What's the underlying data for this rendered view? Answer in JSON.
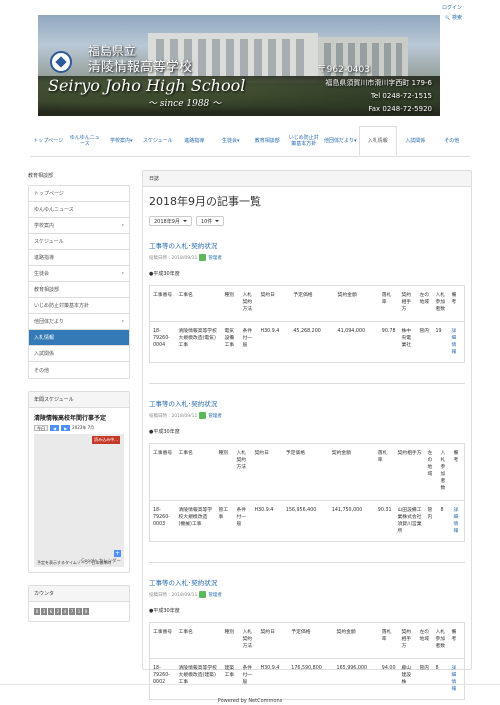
{
  "header": {
    "login": "ログイン",
    "search": "検索"
  },
  "banner": {
    "name_line1": "福島県立",
    "name_line2": "清陵情報高等学校",
    "name_en": "Seiryo Joho High School",
    "since": "〜 since 1988 〜",
    "zip": "〒962-0403",
    "address": "福島県須賀川市滑川字西町 179-6",
    "tel": "Tel  0248-72-1515",
    "fax": "Fax  0248-72-5920"
  },
  "gnav": [
    "トップページ",
    "ゆんゆんニュース",
    "学校案内",
    "スケジュール",
    "進路指導",
    "生徒会",
    "教育相談部",
    "いじめ防止対策基本方針",
    "他団体だより",
    "入札情報",
    "入試関係",
    "その他"
  ],
  "gnav_carets": [
    "",
    "",
    " ▾",
    "",
    "",
    " ▾",
    "",
    "",
    " ▾",
    "",
    "",
    ""
  ],
  "sidebar": {
    "heading": "教育相談部",
    "items": [
      {
        "label": "トップページ",
        "chevron": ""
      },
      {
        "label": "ゆんゆんニュース",
        "chevron": ""
      },
      {
        "label": "学校案内",
        "chevron": "›"
      },
      {
        "label": "スケジュール",
        "chevron": ""
      },
      {
        "label": "進路指導",
        "chevron": ""
      },
      {
        "label": "生徒会",
        "chevron": "›"
      },
      {
        "label": "教育相談部",
        "chevron": ""
      },
      {
        "label": "いじめ防止対策基本方針",
        "chevron": ""
      },
      {
        "label": "他団体だより",
        "chevron": "›"
      },
      {
        "label": "入札情報",
        "chevron": ""
      },
      {
        "label": "入試関係",
        "chevron": ""
      },
      {
        "label": "その他",
        "chevron": ""
      }
    ],
    "calendar": {
      "panel_title": "年間スケジュール",
      "title": "清陵情報高校年間行事予定",
      "today": "今日",
      "prev": "◀",
      "next": "▶",
      "month": "2023年 7月",
      "loading": "読み込み中...",
      "footer": "予定を表示するタイムゾーン: 日本標準時",
      "brand": "Google カレンダー"
    },
    "counter": {
      "title": "カウンタ",
      "digits": [
        "0",
        "3",
        "6",
        "2",
        "4",
        "7",
        "1",
        "9"
      ]
    }
  },
  "main": {
    "breadcrumb": "日誌",
    "title": "2018年9月の記事一覧",
    "filter_month": "2018年9月",
    "filter_count": "10件",
    "headers": [
      "工事番号",
      "工事名",
      "種別",
      "入札契約方法",
      "契約日",
      "予定価格",
      "契約金額",
      "落札率",
      "契約相手方",
      "左の地域",
      "入札参加者数",
      "備考"
    ],
    "articles": [
      {
        "title": "工事等の入札･契約状況",
        "posted": "投稿日時 : 2018/09/11",
        "author": "管理者",
        "year": "●平成30年度",
        "row": [
          "18-79260-0004",
          "清陵情報高等学校大規模改造(電気)工事",
          "電気設備工事",
          "条件付一般",
          "H30.9.4",
          "45,268,200",
          "41,094,000",
          "90.78",
          "株中央電業社",
          "管内",
          "19",
          "詳細情報"
        ]
      },
      {
        "title": "工事等の入札･契約状況",
        "posted": "投稿日時 : 2018/09/11",
        "author": "管理者",
        "year": "●平成30年度",
        "row": [
          "18-79260-0003",
          "清陵情報高等学校大規模改造(機械)工事",
          "管工事",
          "条件付一般",
          "H30.9.4",
          "156,956,400",
          "141,750,000",
          "90.31",
          "山田設備工業株式会社須賀川営業所",
          "管内",
          "8",
          "詳細情報"
        ]
      },
      {
        "title": "工事等の入札･契約状況",
        "posted": "投稿日時 : 2018/09/11",
        "author": "管理者",
        "year": "●平成30年度",
        "row": [
          "18-79260-0002",
          "清陵情報高等学校大規模改造(建築)工事",
          "建築工事",
          "条件付一般",
          "H30.9.4",
          "176,590,800",
          "165,996,000",
          "94.00",
          "藤山建設株",
          "管内",
          "8",
          "詳細情報"
        ]
      }
    ]
  },
  "footer": "Powered by NetCommons"
}
